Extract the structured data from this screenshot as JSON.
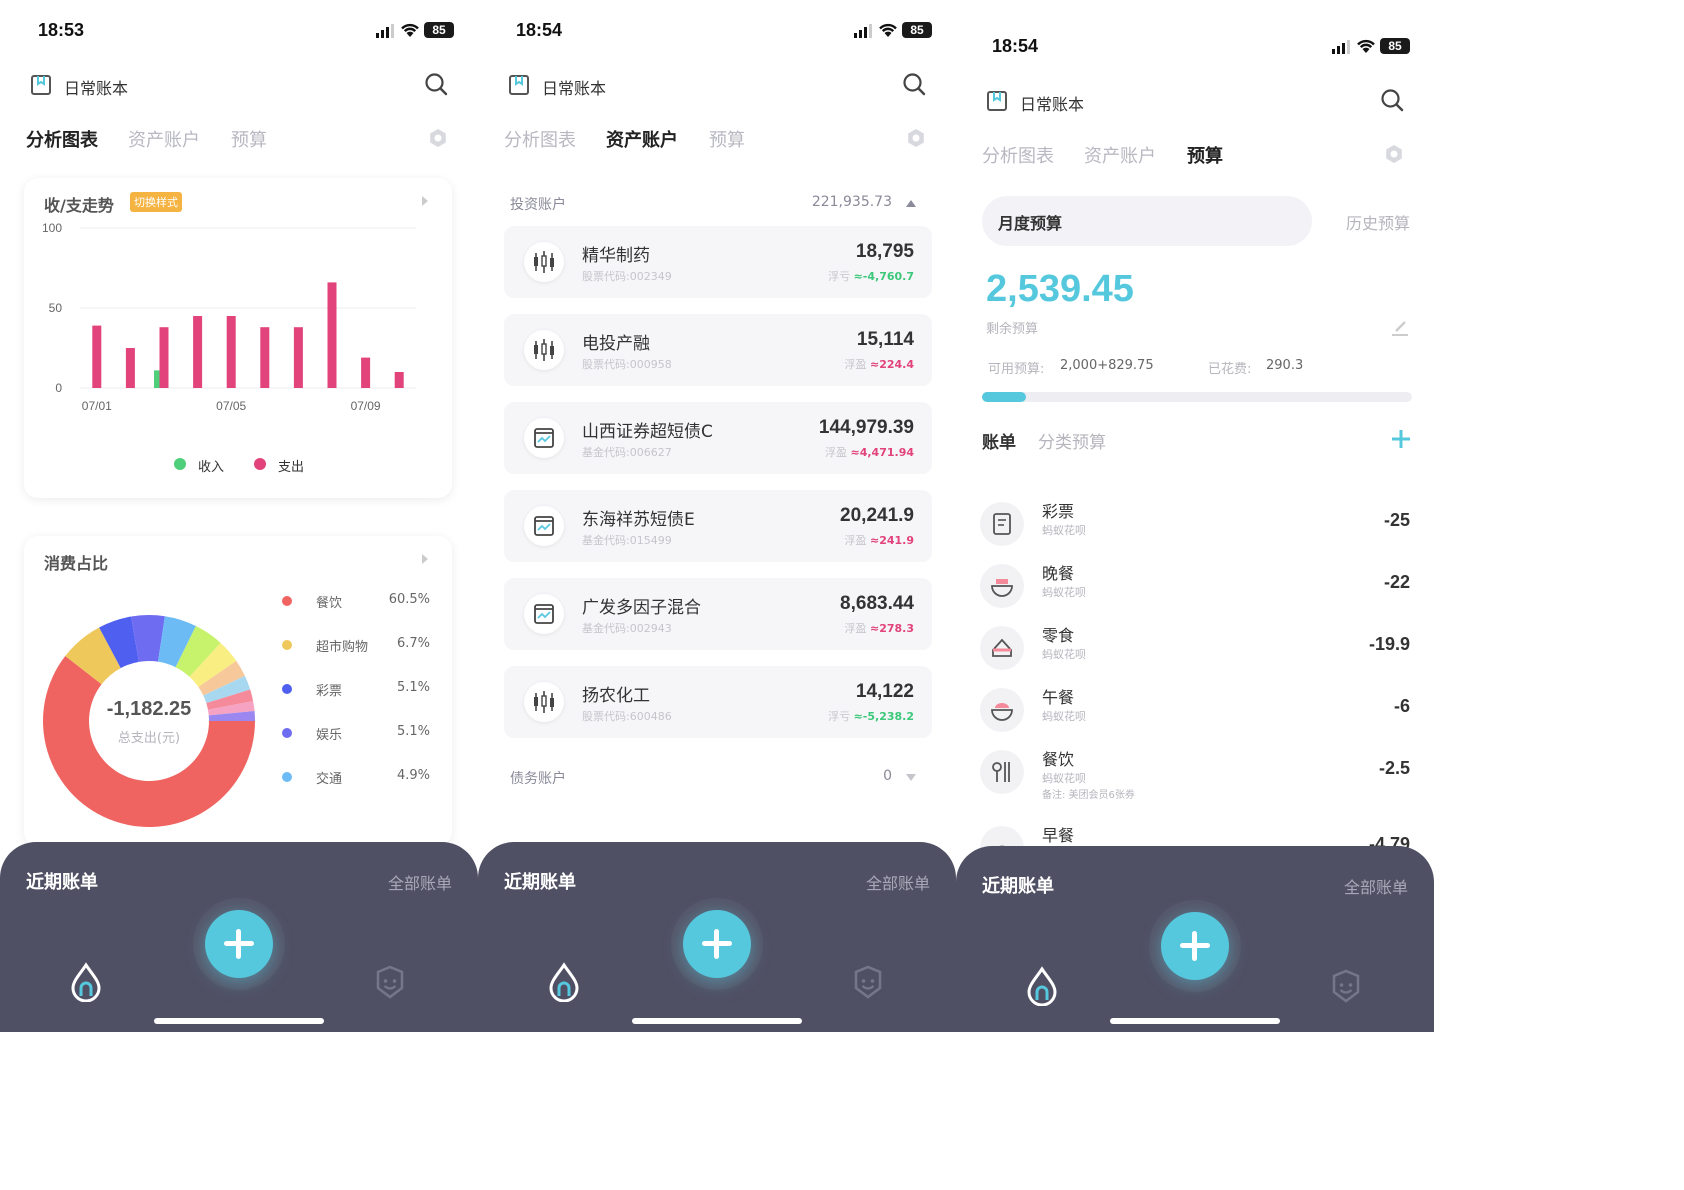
{
  "status": {
    "time_1": "18:53",
    "time_2": "18:54",
    "time_3": "18:54",
    "battery": "85"
  },
  "header": {
    "book_title": "日常账本"
  },
  "tabs": [
    "分析图表",
    "资产账户",
    "预算"
  ],
  "screen1": {
    "trend_card": {
      "title": "收/支走势",
      "badge": "切换样式"
    },
    "ratio_card": {
      "title": "消费占比",
      "center_value": "-1,182.25",
      "center_label": "总支出(元)"
    },
    "legend": [
      {
        "name": "餐饮",
        "pct": "60.5%",
        "color": "#ef6461"
      },
      {
        "name": "超市购物",
        "pct": "6.7%",
        "color": "#eec85a"
      },
      {
        "name": "彩票",
        "pct": "5.1%",
        "color": "#4f5ff0"
      },
      {
        "name": "娱乐",
        "pct": "5.1%",
        "color": "#6e6cf0"
      },
      {
        "name": "交通",
        "pct": "4.9%",
        "color": "#6dbbf5"
      }
    ],
    "donut_extra": [
      {
        "pct": 4.5,
        "color": "#c7f26b"
      },
      {
        "pct": 3.6,
        "color": "#f8ee82"
      },
      {
        "pct": 2.6,
        "color": "#f7c89a"
      },
      {
        "pct": 2.2,
        "color": "#a8d8f0"
      },
      {
        "pct": 1.8,
        "color": "#f58a9a"
      },
      {
        "pct": 1.5,
        "color": "#f6a3c3"
      },
      {
        "pct": 1.5,
        "color": "#9a88f0"
      }
    ]
  },
  "chart_data": {
    "type": "bar",
    "title": "收/支走势",
    "categories": [
      "07/01",
      "07/02",
      "07/03",
      "07/04",
      "07/05",
      "07/06",
      "07/07",
      "07/08",
      "07/09",
      "07/10"
    ],
    "x_tick_labels": [
      "07/01",
      "07/05",
      "07/09"
    ],
    "series": [
      {
        "name": "收入",
        "color": "#4fcf7a",
        "values": [
          0,
          0,
          11,
          0,
          0,
          0,
          0,
          0,
          0,
          0
        ]
      },
      {
        "name": "支出",
        "color": "#e2437a",
        "values": [
          39,
          25,
          38,
          45,
          45,
          38,
          38,
          66,
          19,
          10
        ]
      }
    ],
    "ylim": [
      0,
      100
    ],
    "yticks": [
      0,
      50,
      100
    ],
    "legend": "bottom"
  },
  "screen2": {
    "invest_label": "投资账户",
    "invest_total": "221,935.73",
    "bond_label": "债务账户",
    "bond_total": "0",
    "accounts": [
      {
        "name": "精华制药",
        "code": "股票代码:002349",
        "value": "18,795",
        "pl_label": "浮亏",
        "pl": "≈-4,760.7",
        "pl_color": "#3cc87a"
      },
      {
        "name": "电投产融",
        "code": "股票代码:000958",
        "value": "15,114",
        "pl_label": "浮盈",
        "pl": "≈224.4",
        "pl_color": "#e2437a"
      },
      {
        "name": "山西证券超短债C",
        "code": "基金代码:006627",
        "value": "144,979.39",
        "pl_label": "浮盈",
        "pl": "≈4,471.94",
        "pl_color": "#e2437a"
      },
      {
        "name": "东海祥苏短债E",
        "code": "基金代码:015499",
        "value": "20,241.9",
        "pl_label": "浮盈",
        "pl": "≈241.9",
        "pl_color": "#e2437a"
      },
      {
        "name": "广发多因子混合",
        "code": "基金代码:002943",
        "value": "8,683.44",
        "pl_label": "浮盈",
        "pl": "≈278.3",
        "pl_color": "#e2437a"
      },
      {
        "name": "扬农化工",
        "code": "股票代码:600486",
        "value": "14,122",
        "pl_label": "浮亏",
        "pl": "≈-5,238.2",
        "pl_color": "#3cc87a"
      }
    ]
  },
  "screen3": {
    "monthly_budget": "月度预算",
    "history_budget": "历史预算",
    "remaining_value": "2,539.45",
    "remaining_label": "剩余预算",
    "available_label": "可用预算:",
    "available_value": "2,000+829.75",
    "spent_label": "已花费:",
    "spent_value": "290.3",
    "progress": 0.103,
    "bill_tab": "账单",
    "category_tab": "分类预算",
    "bills": [
      {
        "name": "彩票",
        "sub": "蚂蚁花呗",
        "note": "",
        "amount": "-25"
      },
      {
        "name": "晚餐",
        "sub": "蚂蚁花呗",
        "note": "",
        "amount": "-22"
      },
      {
        "name": "零食",
        "sub": "蚂蚁花呗",
        "note": "",
        "amount": "-19.9"
      },
      {
        "name": "午餐",
        "sub": "蚂蚁花呗",
        "note": "",
        "amount": "-6"
      },
      {
        "name": "餐饮",
        "sub": "蚂蚁花呗",
        "note": "备注: 美团会员6张券",
        "amount": "-2.5"
      },
      {
        "name": "早餐",
        "sub": "",
        "note": "",
        "amount": "-4.79"
      }
    ]
  },
  "bottom": {
    "recent": "近期账单",
    "all": "全部账单"
  },
  "colors": {
    "accent": "#55c8dd",
    "sheet": "#505064",
    "income": "#4fcf7a",
    "expense": "#e2437a"
  }
}
